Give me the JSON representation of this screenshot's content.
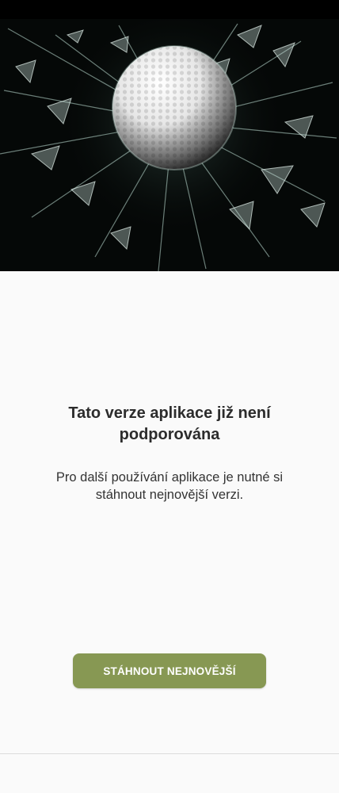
{
  "hero": {
    "image": "golf-ball-breaking-glass"
  },
  "message": {
    "title": "Tato verze aplikace již není podporována",
    "subtitle": "Pro další používání aplikace je nutné si stáhnout nejnovější verzi."
  },
  "actions": {
    "download_label": "STÁHNOUT NEJNOVĚJŠÍ"
  },
  "colors": {
    "button": "#879853",
    "background": "#fafafa",
    "hero_background": "#000000"
  }
}
